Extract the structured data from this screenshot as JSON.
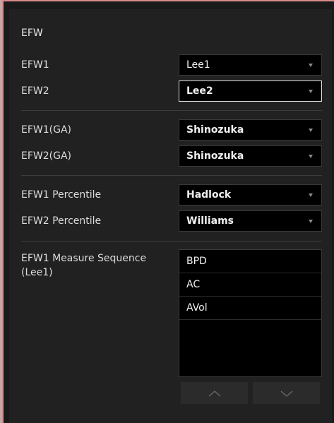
{
  "section": {
    "title": "EFW"
  },
  "rows": [
    {
      "label": "EFW1",
      "value": "Lee1"
    },
    {
      "label": "EFW2",
      "value": "Lee2"
    },
    {
      "label": "EFW1(GA)",
      "value": "Shinozuka"
    },
    {
      "label": "EFW2(GA)",
      "value": "Shinozuka"
    },
    {
      "label": "EFW1 Percentile",
      "value": "Hadlock"
    },
    {
      "label": "EFW2 Percentile",
      "value": "Williams"
    }
  ],
  "sequence": {
    "label_line1": "EFW1 Measure Sequence",
    "label_line2": "(Lee1)",
    "items": [
      "BPD",
      "AC",
      "AVol"
    ]
  },
  "buttons": {
    "up_icon": "chevron-up-icon",
    "down_icon": "chevron-down-icon"
  },
  "colors": {
    "panel": "#212121",
    "accent_border": "#d88a8a",
    "field": "#000000"
  }
}
